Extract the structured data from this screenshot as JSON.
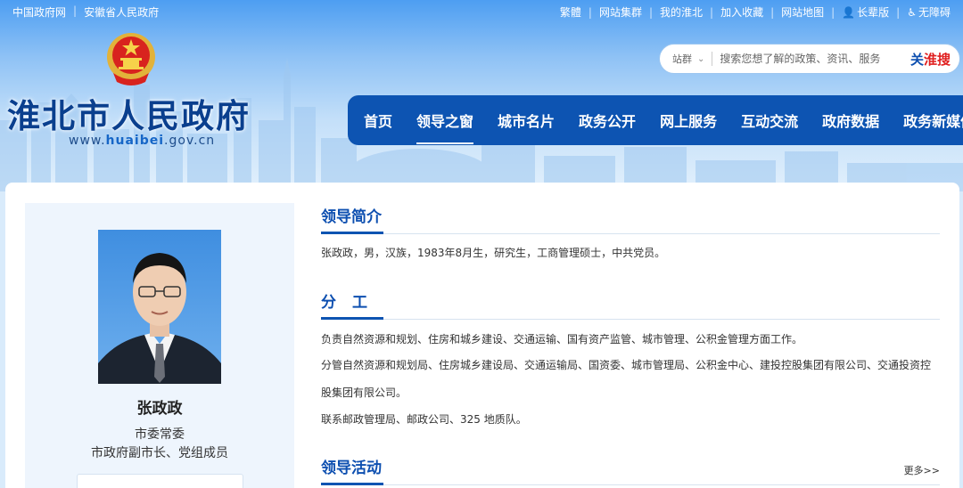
{
  "topbar": {
    "left_links": [
      "中国政府网",
      "安徽省人民政府"
    ],
    "right_links": [
      "繁體",
      "网站集群",
      "我的淮北",
      "加入收藏",
      "网站地图"
    ],
    "elder_version": "长辈版",
    "accessibility": "无障碍"
  },
  "header": {
    "site_title": "淮北市人民政府",
    "url_prefix": "www.",
    "url_highlight": "huaibei",
    "url_suffix": ".gov.cn"
  },
  "search": {
    "scope": "站群",
    "placeholder": "搜索您想了解的政策、资讯、服务",
    "brand_part1": "关",
    "brand_part2": "淮",
    "brand_part3": "搜"
  },
  "nav": {
    "items": [
      "首页",
      "领导之窗",
      "城市名片",
      "政务公开",
      "网上服务",
      "互动交流",
      "政府数据",
      "政务新媒体"
    ],
    "active_index": 1
  },
  "leader": {
    "name": "张政政",
    "title1": "市委常委",
    "title2": "市政府副市长、党组成员"
  },
  "sections": {
    "intro": {
      "title": "领导简介",
      "text": "张政政，男，汉族，1983年8月生，研究生，工商管理硕士，中共党员。"
    },
    "duty": {
      "title": "分工",
      "line1": "负责自然资源和规划、住房和城乡建设、交通运输、国有资产监管、城市管理、公积金管理方面工作。",
      "line2": "分管自然资源和规划局、住房城乡建设局、交通运输局、国资委、城市管理局、公积金中心、建投控股集团有限公司、交通投资控",
      "line3": "股集团有限公司。",
      "line4": "联系邮政管理局、邮政公司、325 地质队。"
    },
    "activity": {
      "title": "领导活动",
      "more": "更多>>"
    }
  },
  "colors": {
    "nav_bg": "#0d54b2",
    "title_blue": "#0a3f8e",
    "accent_red": "#e02020"
  }
}
